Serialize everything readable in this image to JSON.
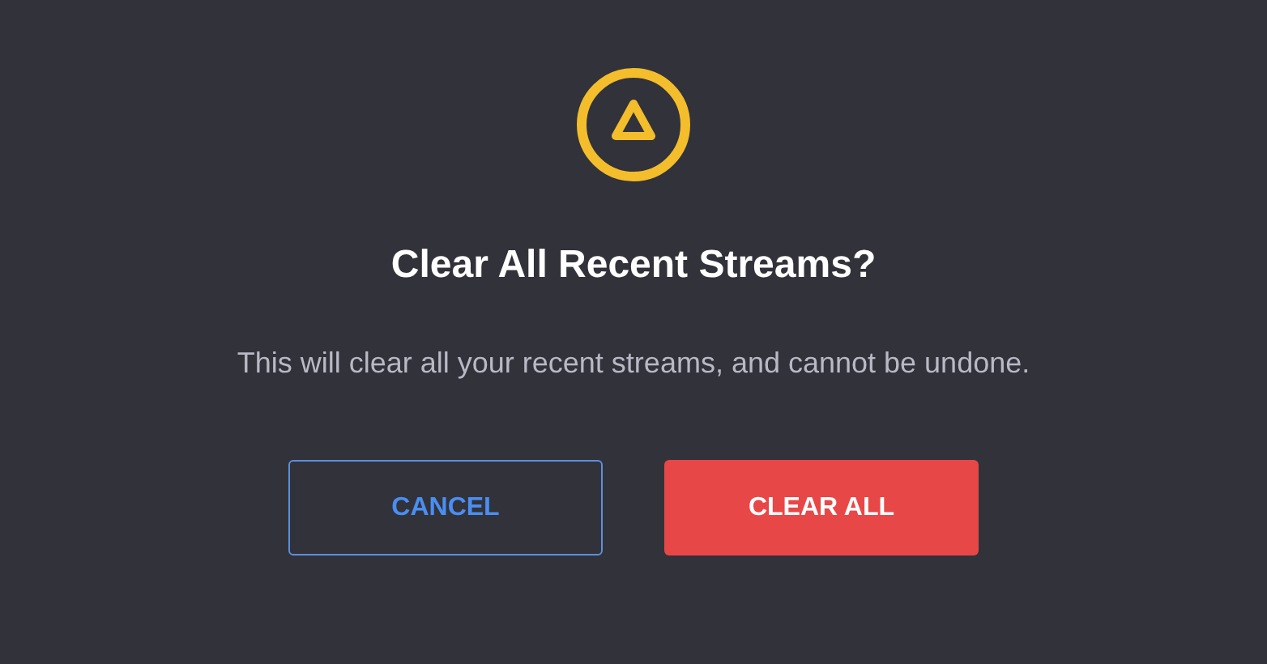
{
  "dialog": {
    "title": "Clear All Recent Streams?",
    "message": "This will clear all your recent streams, and cannot be undone.",
    "buttons": [
      {
        "label": "CANCEL",
        "kind": "secondary"
      },
      {
        "label": "CLEAR ALL",
        "kind": "danger"
      }
    ]
  }
}
